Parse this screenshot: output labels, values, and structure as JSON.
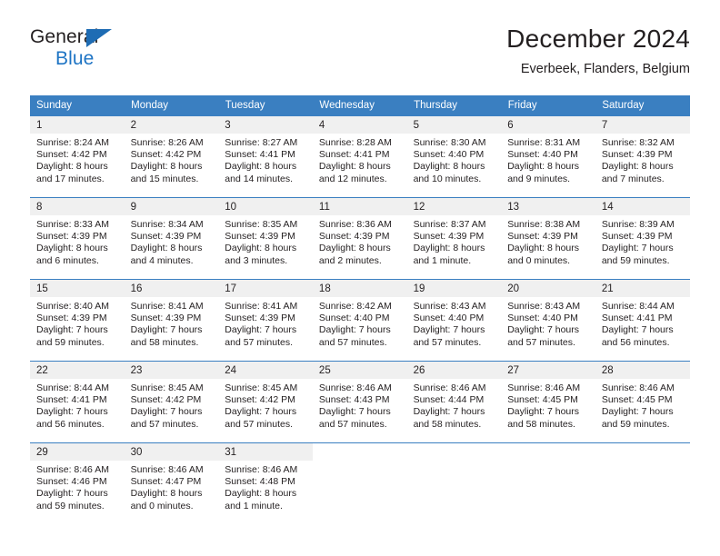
{
  "logo": {
    "line1": "General",
    "line2": "Blue",
    "triangle_color": "#1e6cb4"
  },
  "header": {
    "title": "December 2024",
    "subtitle": "Everbeek, Flanders, Belgium"
  },
  "theme": {
    "header_blue": "#3a7fc1",
    "daynum_bg": "#f0f0f0",
    "text": "#231f20"
  },
  "weekday_headers": [
    "Sunday",
    "Monday",
    "Tuesday",
    "Wednesday",
    "Thursday",
    "Friday",
    "Saturday"
  ],
  "weeks": [
    [
      {
        "day": "1",
        "sunrise": "Sunrise: 8:24 AM",
        "sunset": "Sunset: 4:42 PM",
        "daylight1": "Daylight: 8 hours",
        "daylight2": "and 17 minutes."
      },
      {
        "day": "2",
        "sunrise": "Sunrise: 8:26 AM",
        "sunset": "Sunset: 4:42 PM",
        "daylight1": "Daylight: 8 hours",
        "daylight2": "and 15 minutes."
      },
      {
        "day": "3",
        "sunrise": "Sunrise: 8:27 AM",
        "sunset": "Sunset: 4:41 PM",
        "daylight1": "Daylight: 8 hours",
        "daylight2": "and 14 minutes."
      },
      {
        "day": "4",
        "sunrise": "Sunrise: 8:28 AM",
        "sunset": "Sunset: 4:41 PM",
        "daylight1": "Daylight: 8 hours",
        "daylight2": "and 12 minutes."
      },
      {
        "day": "5",
        "sunrise": "Sunrise: 8:30 AM",
        "sunset": "Sunset: 4:40 PM",
        "daylight1": "Daylight: 8 hours",
        "daylight2": "and 10 minutes."
      },
      {
        "day": "6",
        "sunrise": "Sunrise: 8:31 AM",
        "sunset": "Sunset: 4:40 PM",
        "daylight1": "Daylight: 8 hours",
        "daylight2": "and 9 minutes."
      },
      {
        "day": "7",
        "sunrise": "Sunrise: 8:32 AM",
        "sunset": "Sunset: 4:39 PM",
        "daylight1": "Daylight: 8 hours",
        "daylight2": "and 7 minutes."
      }
    ],
    [
      {
        "day": "8",
        "sunrise": "Sunrise: 8:33 AM",
        "sunset": "Sunset: 4:39 PM",
        "daylight1": "Daylight: 8 hours",
        "daylight2": "and 6 minutes."
      },
      {
        "day": "9",
        "sunrise": "Sunrise: 8:34 AM",
        "sunset": "Sunset: 4:39 PM",
        "daylight1": "Daylight: 8 hours",
        "daylight2": "and 4 minutes."
      },
      {
        "day": "10",
        "sunrise": "Sunrise: 8:35 AM",
        "sunset": "Sunset: 4:39 PM",
        "daylight1": "Daylight: 8 hours",
        "daylight2": "and 3 minutes."
      },
      {
        "day": "11",
        "sunrise": "Sunrise: 8:36 AM",
        "sunset": "Sunset: 4:39 PM",
        "daylight1": "Daylight: 8 hours",
        "daylight2": "and 2 minutes."
      },
      {
        "day": "12",
        "sunrise": "Sunrise: 8:37 AM",
        "sunset": "Sunset: 4:39 PM",
        "daylight1": "Daylight: 8 hours",
        "daylight2": "and 1 minute."
      },
      {
        "day": "13",
        "sunrise": "Sunrise: 8:38 AM",
        "sunset": "Sunset: 4:39 PM",
        "daylight1": "Daylight: 8 hours",
        "daylight2": "and 0 minutes."
      },
      {
        "day": "14",
        "sunrise": "Sunrise: 8:39 AM",
        "sunset": "Sunset: 4:39 PM",
        "daylight1": "Daylight: 7 hours",
        "daylight2": "and 59 minutes."
      }
    ],
    [
      {
        "day": "15",
        "sunrise": "Sunrise: 8:40 AM",
        "sunset": "Sunset: 4:39 PM",
        "daylight1": "Daylight: 7 hours",
        "daylight2": "and 59 minutes."
      },
      {
        "day": "16",
        "sunrise": "Sunrise: 8:41 AM",
        "sunset": "Sunset: 4:39 PM",
        "daylight1": "Daylight: 7 hours",
        "daylight2": "and 58 minutes."
      },
      {
        "day": "17",
        "sunrise": "Sunrise: 8:41 AM",
        "sunset": "Sunset: 4:39 PM",
        "daylight1": "Daylight: 7 hours",
        "daylight2": "and 57 minutes."
      },
      {
        "day": "18",
        "sunrise": "Sunrise: 8:42 AM",
        "sunset": "Sunset: 4:40 PM",
        "daylight1": "Daylight: 7 hours",
        "daylight2": "and 57 minutes."
      },
      {
        "day": "19",
        "sunrise": "Sunrise: 8:43 AM",
        "sunset": "Sunset: 4:40 PM",
        "daylight1": "Daylight: 7 hours",
        "daylight2": "and 57 minutes."
      },
      {
        "day": "20",
        "sunrise": "Sunrise: 8:43 AM",
        "sunset": "Sunset: 4:40 PM",
        "daylight1": "Daylight: 7 hours",
        "daylight2": "and 57 minutes."
      },
      {
        "day": "21",
        "sunrise": "Sunrise: 8:44 AM",
        "sunset": "Sunset: 4:41 PM",
        "daylight1": "Daylight: 7 hours",
        "daylight2": "and 56 minutes."
      }
    ],
    [
      {
        "day": "22",
        "sunrise": "Sunrise: 8:44 AM",
        "sunset": "Sunset: 4:41 PM",
        "daylight1": "Daylight: 7 hours",
        "daylight2": "and 56 minutes."
      },
      {
        "day": "23",
        "sunrise": "Sunrise: 8:45 AM",
        "sunset": "Sunset: 4:42 PM",
        "daylight1": "Daylight: 7 hours",
        "daylight2": "and 57 minutes."
      },
      {
        "day": "24",
        "sunrise": "Sunrise: 8:45 AM",
        "sunset": "Sunset: 4:42 PM",
        "daylight1": "Daylight: 7 hours",
        "daylight2": "and 57 minutes."
      },
      {
        "day": "25",
        "sunrise": "Sunrise: 8:46 AM",
        "sunset": "Sunset: 4:43 PM",
        "daylight1": "Daylight: 7 hours",
        "daylight2": "and 57 minutes."
      },
      {
        "day": "26",
        "sunrise": "Sunrise: 8:46 AM",
        "sunset": "Sunset: 4:44 PM",
        "daylight1": "Daylight: 7 hours",
        "daylight2": "and 58 minutes."
      },
      {
        "day": "27",
        "sunrise": "Sunrise: 8:46 AM",
        "sunset": "Sunset: 4:45 PM",
        "daylight1": "Daylight: 7 hours",
        "daylight2": "and 58 minutes."
      },
      {
        "day": "28",
        "sunrise": "Sunrise: 8:46 AM",
        "sunset": "Sunset: 4:45 PM",
        "daylight1": "Daylight: 7 hours",
        "daylight2": "and 59 minutes."
      }
    ],
    [
      {
        "day": "29",
        "sunrise": "Sunrise: 8:46 AM",
        "sunset": "Sunset: 4:46 PM",
        "daylight1": "Daylight: 7 hours",
        "daylight2": "and 59 minutes."
      },
      {
        "day": "30",
        "sunrise": "Sunrise: 8:46 AM",
        "sunset": "Sunset: 4:47 PM",
        "daylight1": "Daylight: 8 hours",
        "daylight2": "and 0 minutes."
      },
      {
        "day": "31",
        "sunrise": "Sunrise: 8:46 AM",
        "sunset": "Sunset: 4:48 PM",
        "daylight1": "Daylight: 8 hours",
        "daylight2": "and 1 minute."
      },
      {
        "day": "",
        "sunrise": "",
        "sunset": "",
        "daylight1": "",
        "daylight2": ""
      },
      {
        "day": "",
        "sunrise": "",
        "sunset": "",
        "daylight1": "",
        "daylight2": ""
      },
      {
        "day": "",
        "sunrise": "",
        "sunset": "",
        "daylight1": "",
        "daylight2": ""
      },
      {
        "day": "",
        "sunrise": "",
        "sunset": "",
        "daylight1": "",
        "daylight2": ""
      }
    ]
  ]
}
